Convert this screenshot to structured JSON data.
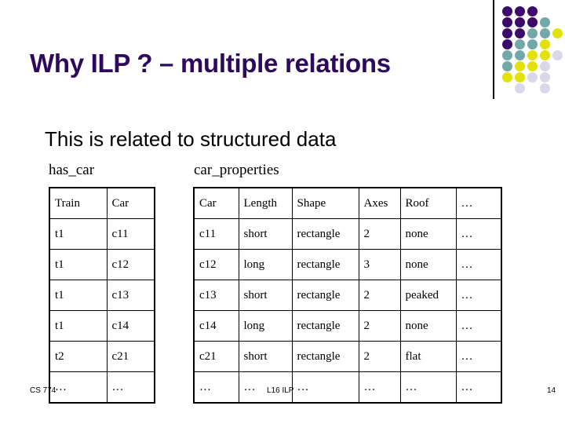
{
  "slide": {
    "title": "Why ILP ? – multiple relations",
    "subtitle": "This is related to structured data",
    "title_color": "#2d0a5e"
  },
  "captions": {
    "has_car": "has_car",
    "car_properties": "car_properties"
  },
  "has_car_table": {
    "headers": [
      "Train",
      "Car"
    ],
    "rows": [
      [
        "t1",
        "c11"
      ],
      [
        "t1",
        "c12"
      ],
      [
        "t1",
        "c13"
      ],
      [
        "t1",
        "c14"
      ],
      [
        "t2",
        "c21"
      ],
      [
        "…",
        "…"
      ]
    ]
  },
  "car_properties_table": {
    "headers": [
      "Car",
      "Length",
      "Shape",
      "Axes",
      "Roof",
      "…"
    ],
    "rows": [
      [
        "c11",
        "short",
        "rectangle",
        "2",
        "none",
        "…"
      ],
      [
        "c12",
        "long",
        "rectangle",
        "3",
        "none",
        "…"
      ],
      [
        "c13",
        "short",
        "rectangle",
        "2",
        "peaked",
        "…"
      ],
      [
        "c14",
        "long",
        "rectangle",
        "2",
        "none",
        "…"
      ],
      [
        "c21",
        "short",
        "rectangle",
        "2",
        "flat",
        "…"
      ],
      [
        "…",
        "…",
        "…",
        "…",
        "…",
        "…"
      ]
    ]
  },
  "footer": {
    "course": "CS 774",
    "lecture": "L16 ILP",
    "page": "14"
  },
  "decoration": {
    "palette": {
      "purple": "#3b0a6b",
      "teal": "#73a8a8",
      "yellow": "#e2e20a",
      "lavender": "#d8d8e8"
    },
    "dots": [
      {
        "col": 0,
        "row": 0,
        "color": "#3b0a6b"
      },
      {
        "col": 1,
        "row": 0,
        "color": "#3b0a6b"
      },
      {
        "col": 2,
        "row": 0,
        "color": "#3b0a6b"
      },
      {
        "col": 0,
        "row": 1,
        "color": "#3b0a6b"
      },
      {
        "col": 1,
        "row": 1,
        "color": "#3b0a6b"
      },
      {
        "col": 2,
        "row": 1,
        "color": "#3b0a6b"
      },
      {
        "col": 3,
        "row": 1,
        "color": "#73a8a8"
      },
      {
        "col": 0,
        "row": 2,
        "color": "#3b0a6b"
      },
      {
        "col": 1,
        "row": 2,
        "color": "#3b0a6b"
      },
      {
        "col": 2,
        "row": 2,
        "color": "#73a8a8"
      },
      {
        "col": 3,
        "row": 2,
        "color": "#73a8a8"
      },
      {
        "col": 4,
        "row": 2,
        "color": "#e2e20a"
      },
      {
        "col": 0,
        "row": 3,
        "color": "#3b0a6b"
      },
      {
        "col": 1,
        "row": 3,
        "color": "#73a8a8"
      },
      {
        "col": 2,
        "row": 3,
        "color": "#73a8a8"
      },
      {
        "col": 3,
        "row": 3,
        "color": "#e2e20a"
      },
      {
        "col": 0,
        "row": 4,
        "color": "#73a8a8"
      },
      {
        "col": 1,
        "row": 4,
        "color": "#73a8a8"
      },
      {
        "col": 2,
        "row": 4,
        "color": "#e2e20a"
      },
      {
        "col": 3,
        "row": 4,
        "color": "#e2e20a"
      },
      {
        "col": 4,
        "row": 4,
        "color": "#d8d8e8"
      },
      {
        "col": 0,
        "row": 5,
        "color": "#73a8a8"
      },
      {
        "col": 1,
        "row": 5,
        "color": "#e2e20a"
      },
      {
        "col": 2,
        "row": 5,
        "color": "#e2e20a"
      },
      {
        "col": 3,
        "row": 5,
        "color": "#d8d8e8"
      },
      {
        "col": 0,
        "row": 6,
        "color": "#e2e20a"
      },
      {
        "col": 1,
        "row": 6,
        "color": "#e2e20a"
      },
      {
        "col": 2,
        "row": 6,
        "color": "#d8d8e8"
      },
      {
        "col": 3,
        "row": 6,
        "color": "#d8d8e8"
      },
      {
        "col": 1,
        "row": 7,
        "color": "#d8d8e8"
      },
      {
        "col": 3,
        "row": 7,
        "color": "#d8d8e8"
      }
    ]
  }
}
